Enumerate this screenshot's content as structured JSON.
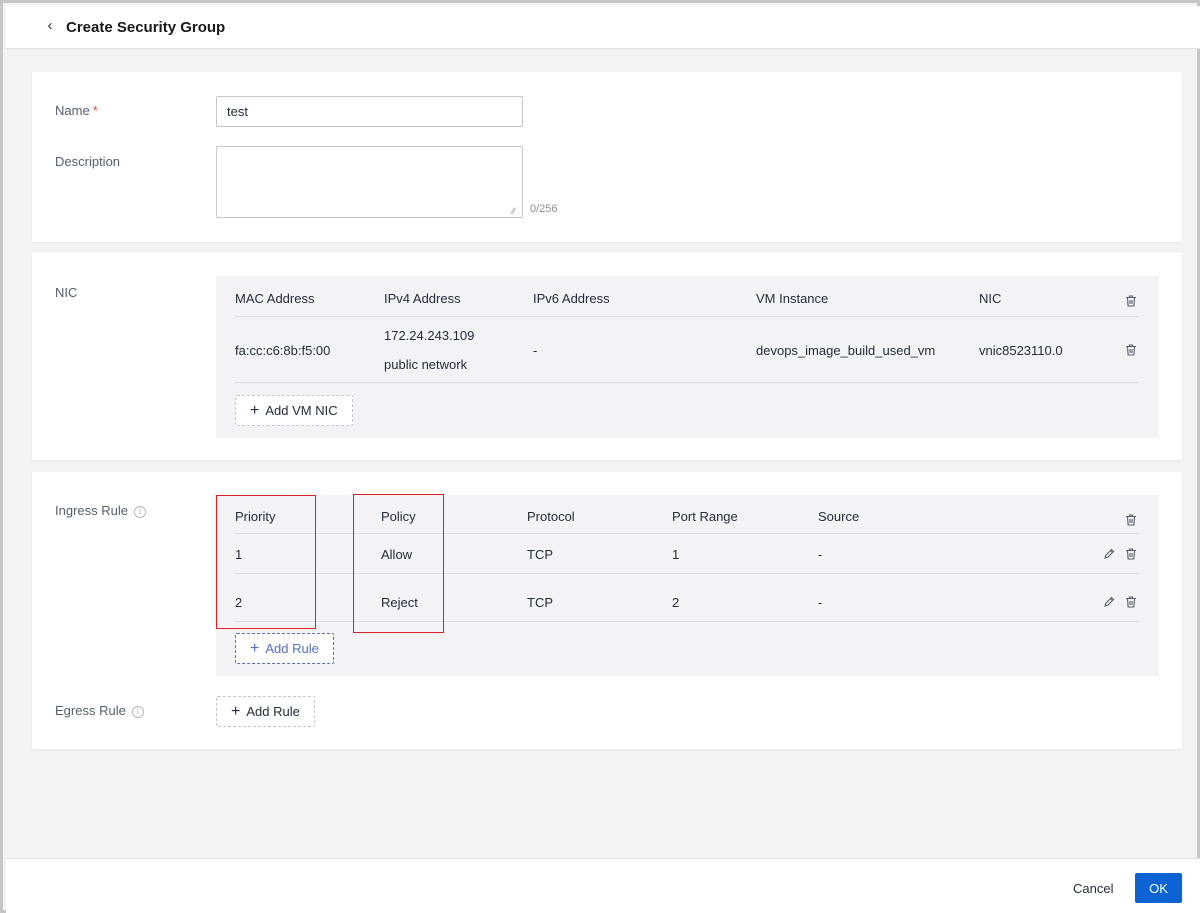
{
  "header": {
    "back_icon": "chevron-left-icon",
    "title": "Create Security Group"
  },
  "basic": {
    "name_label": "Name",
    "required_mark": "*",
    "name_value": "test",
    "description_label": "Description",
    "description_value": "",
    "description_counter": "0/256"
  },
  "nic": {
    "label": "NIC",
    "columns": [
      "MAC Address",
      "IPv4 Address",
      "IPv6 Address",
      "VM Instance",
      "NIC"
    ],
    "rows": [
      {
        "mac": "fa:cc:c6:8b:f5:00",
        "ipv4": "172.24.243.109",
        "ipv4_network": "public network",
        "ipv6": "-",
        "vm_instance": "devops_image_build_used_vm",
        "nic": "vnic8523110.0"
      }
    ],
    "add_button": "Add VM NIC"
  },
  "ingress": {
    "label": "Ingress Rule",
    "columns": [
      "Priority",
      "Policy",
      "Protocol",
      "Port Range",
      "Source"
    ],
    "rows": [
      {
        "priority": "1",
        "policy": "Allow",
        "protocol": "TCP",
        "port_range": "1",
        "source": "-"
      },
      {
        "priority": "2",
        "policy": "Reject",
        "protocol": "TCP",
        "port_range": "2",
        "source": "-"
      }
    ],
    "add_button": "Add Rule"
  },
  "egress": {
    "label": "Egress Rule",
    "add_button": "Add Rule"
  },
  "footer": {
    "cancel": "Cancel",
    "ok": "OK"
  },
  "colors": {
    "primary": "#0c63d4",
    "highlight": "#e02020",
    "required": "#e54545"
  }
}
